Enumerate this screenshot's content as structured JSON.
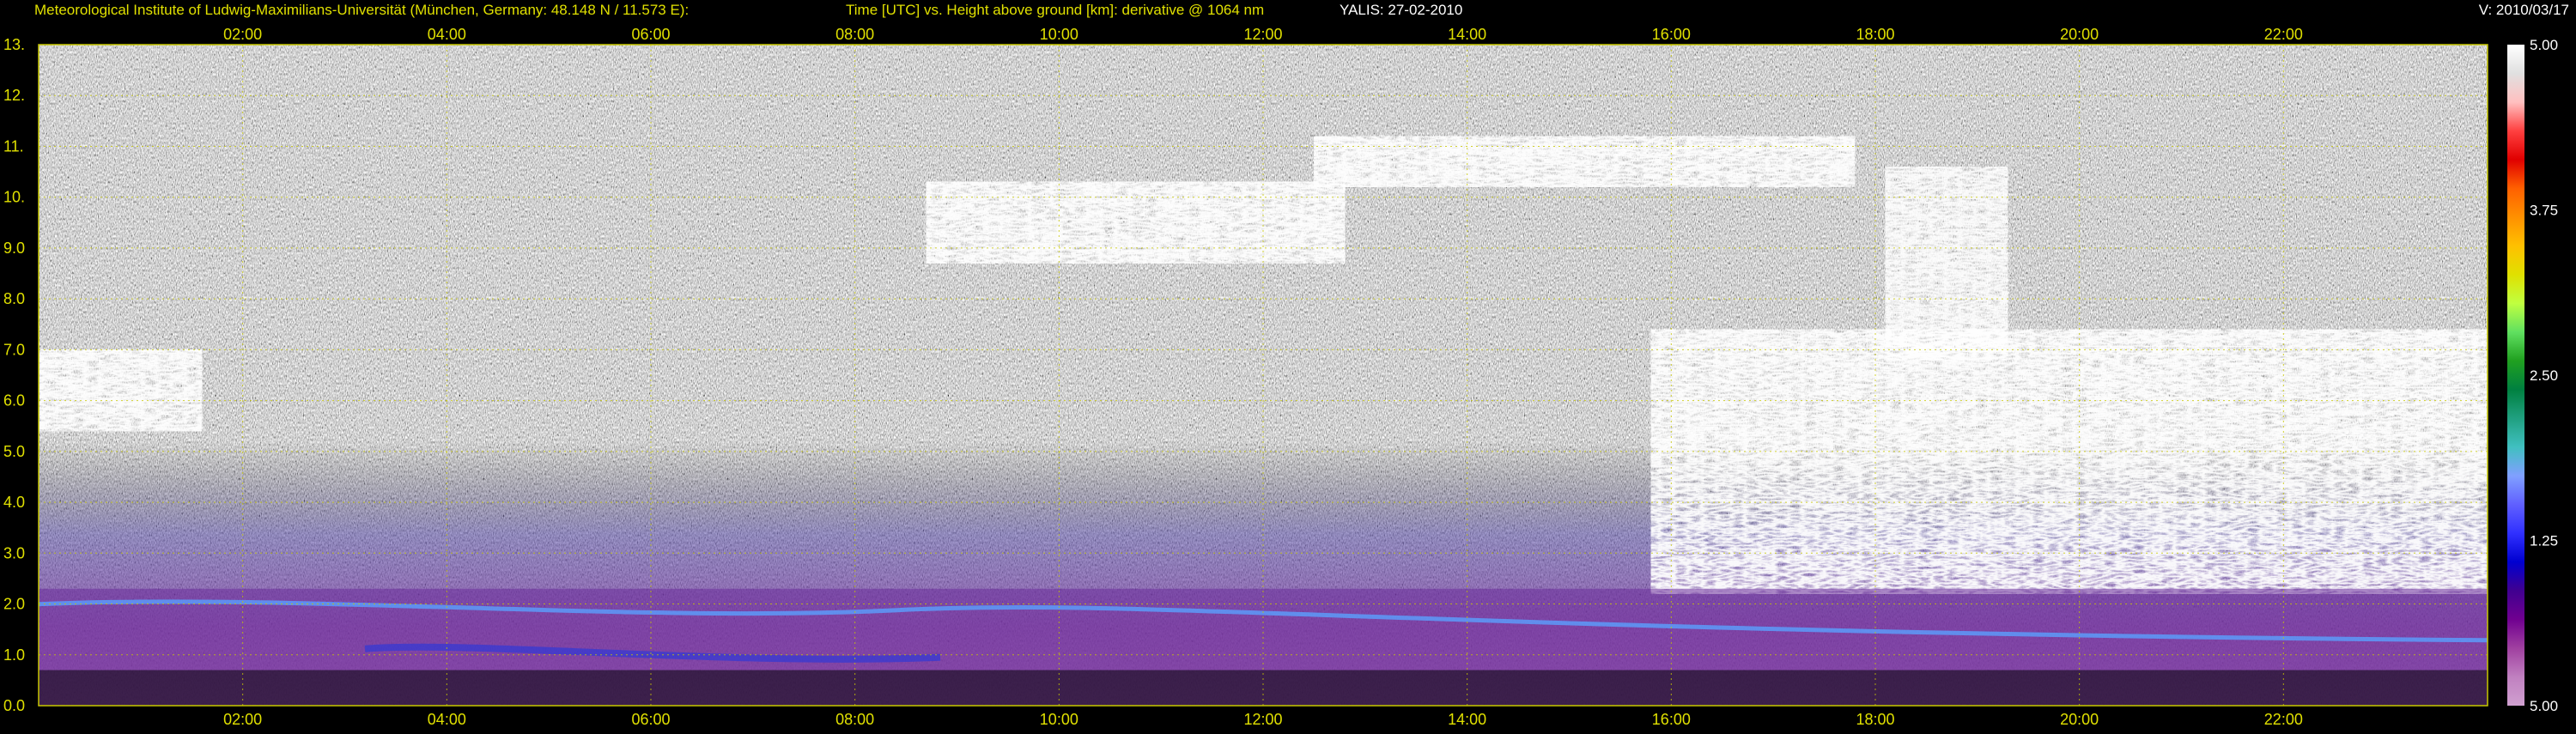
{
  "header": {
    "institute": "Meteorological Institute of Ludwig-Maximilians-Universität (München, Germany: 48.148 N / 11.573 E):",
    "description": "Time [UTC] vs. Height above ground [km]: derivative @ 1064 nm",
    "instrument": "YALIS: 27-02-2010",
    "version": "V: 2010/03/17"
  },
  "colors": {
    "background": "#000000",
    "text_yellow": "#e0e000",
    "grid": "#c8c800",
    "noise_gray": "#8a8a8a",
    "aerosol_purple": "#7a2fa0",
    "aerosol_blue": "#3a3ad0",
    "cloud_white": "#ffffff"
  },
  "chart_data": {
    "type": "heatmap",
    "title": "Time [UTC] vs. Height above ground [km]: derivative @ 1064 nm",
    "x_unit": "hour UTC",
    "xlim": [
      0,
      24
    ],
    "ylim": [
      0,
      13
    ],
    "x_ticks": [
      "02:00",
      "04:00",
      "06:00",
      "08:00",
      "10:00",
      "12:00",
      "14:00",
      "16:00",
      "18:00",
      "20:00",
      "22:00"
    ],
    "x_tick_values": [
      2,
      4,
      6,
      8,
      10,
      12,
      14,
      16,
      18,
      20,
      22
    ],
    "y_ticks": [
      "13.",
      "12.",
      "11.",
      "10.",
      "9.0",
      "8.0",
      "7.0",
      "6.0",
      "5.0",
      "4.0",
      "3.0",
      "2.0",
      "1.0",
      "0.0"
    ],
    "y_tick_values": [
      13,
      12,
      11,
      10,
      9,
      8,
      7,
      6,
      5,
      4,
      3,
      2,
      1,
      0
    ],
    "grid": true,
    "colorbar": {
      "labels": [
        "5.00",
        "3.75",
        "2.50",
        "1.25",
        "5.00"
      ],
      "colors": [
        "#ffffff",
        "#e0e0e0",
        "#ffc0c0",
        "#ff4040",
        "#e00000",
        "#ff6000",
        "#ff9000",
        "#ffc000",
        "#e0e000",
        "#c0ff40",
        "#60e060",
        "#20a020",
        "#008040",
        "#20a080",
        "#40c0c0",
        "#80a0ff",
        "#6060ff",
        "#3030ff",
        "#0000d0",
        "#400090",
        "#700090",
        "#a040a0",
        "#c080c0",
        "#d0a0d0"
      ]
    },
    "features": [
      {
        "name": "cirrus_upper",
        "x_start": 12.5,
        "x_end": 17.8,
        "y_bottom": 10.2,
        "y_top": 11.2
      },
      {
        "name": "cirrus_mid",
        "x_start": 8.7,
        "x_end": 12.8,
        "y_bottom": 8.7,
        "y_top": 10.3
      },
      {
        "name": "cloud_left",
        "x_start": 0.0,
        "x_end": 1.6,
        "y_bottom": 5.4,
        "y_top": 7.0
      },
      {
        "name": "cloud_front_right",
        "x_start": 15.8,
        "x_end": 24.0,
        "y_bottom": 2.2,
        "y_top": 10.6
      },
      {
        "name": "boundary_layer",
        "x_start": 0.0,
        "x_end": 24.0,
        "y_bottom": 0.0,
        "y_top": 2.3
      }
    ]
  }
}
